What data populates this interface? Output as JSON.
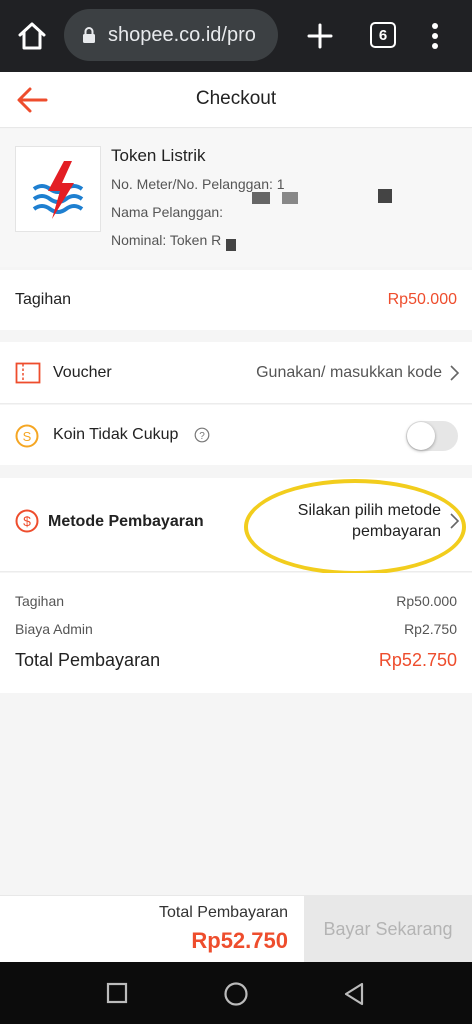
{
  "browser": {
    "url": "shopee.co.id/pro",
    "tab_count": "6"
  },
  "header": {
    "title": "Checkout"
  },
  "product": {
    "name": "Token Listrik",
    "meter_label": "No. Meter/No. Pelanggan: 1",
    "customer_label": "Nama Pelanggan:",
    "nominal_label": "Nominal: Token R"
  },
  "tagihan": {
    "label": "Tagihan",
    "value": "Rp50.000"
  },
  "voucher": {
    "label": "Voucher",
    "value": "Gunakan/ masukkan kode"
  },
  "koin": {
    "label": "Koin Tidak Cukup",
    "enabled": false
  },
  "payment_method": {
    "label": "Metode Pembayaran",
    "value_line1": "Silakan pilih metode",
    "value_line2": "pembayaran"
  },
  "summary": {
    "tagihan_label": "Tagihan",
    "tagihan_value": "Rp50.000",
    "admin_label": "Biaya Admin",
    "admin_value": "Rp2.750",
    "total_label": "Total Pembayaran",
    "total_value": "Rp52.750"
  },
  "bottom": {
    "total_label": "Total Pembayaran",
    "total_value": "Rp52.750",
    "pay_label": "Bayar Sekarang"
  },
  "colors": {
    "brand": "#ee4d2d",
    "highlight": "#f2cd1d"
  }
}
